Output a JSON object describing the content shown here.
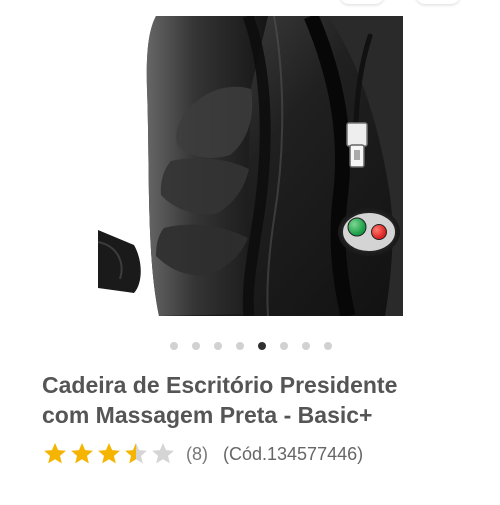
{
  "carousel": {
    "dot_count": 8,
    "active_index": 4
  },
  "product": {
    "title_line_1": "Cadeira de Escritório Presidente",
    "title_line_2": "com Massagem Preta - Basic+",
    "rating": {
      "value": 3.5,
      "max": 5,
      "count_text": "(8)"
    },
    "code_text": "(Cód.134577446)"
  },
  "colors": {
    "star_filled": "#f4b400",
    "star_empty": "#d5d5d5",
    "title": "#555555"
  },
  "icons": {
    "rating": "star-icon"
  }
}
